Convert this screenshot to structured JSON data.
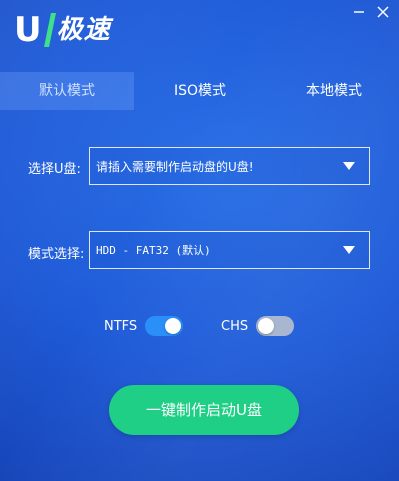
{
  "app": {
    "logo_letter": "U",
    "logo_text": "极速"
  },
  "window_controls": {
    "minimize_icon": "minimize-icon",
    "close_icon": "close-icon"
  },
  "tabs": [
    {
      "label": "默认模式",
      "active": true
    },
    {
      "label": "ISO模式",
      "active": false
    },
    {
      "label": "本地模式",
      "active": false
    }
  ],
  "form": {
    "usb_label": "选择U盘:",
    "usb_value": "请插入需要制作启动盘的U盘!",
    "mode_label": "模式选择:",
    "mode_value": "HDD - FAT32 (默认)"
  },
  "toggles": [
    {
      "label": "NTFS",
      "on": true
    },
    {
      "label": "CHS",
      "on": false
    }
  ],
  "action": {
    "make_label": "一键制作启动U盘"
  },
  "colors": {
    "background": "#1f5bd8",
    "accent_green": "#1fcf86",
    "toggle_on": "#2a8ff7",
    "toggle_off": "#a9b6cf",
    "logo_slash": "#3fe08a"
  }
}
